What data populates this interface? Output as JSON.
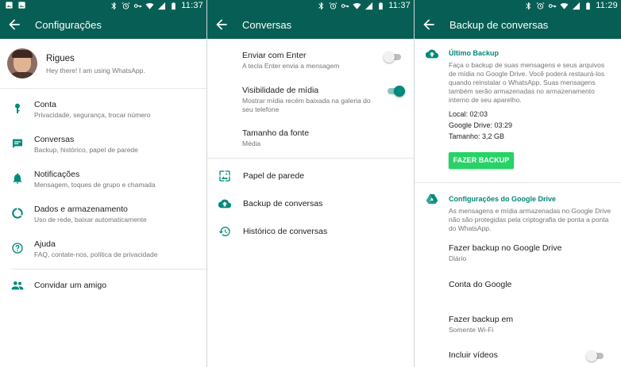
{
  "colors": {
    "header": "#075e54",
    "accent": "#00897b",
    "button": "#25d366"
  },
  "panels": [
    {
      "time": "11:37",
      "title": "Configurações",
      "profile": {
        "name": "Rigues",
        "status": "Hey there! I am using WhatsApp."
      },
      "items": [
        {
          "icon": "key-icon",
          "title": "Conta",
          "subtitle": "Privacidade, segurança, trocar número"
        },
        {
          "icon": "chat-icon",
          "title": "Conversas",
          "subtitle": "Backup, histórico, papel de parede"
        },
        {
          "icon": "bell-icon",
          "title": "Notificações",
          "subtitle": "Mensagem, toques de grupo e chamada"
        },
        {
          "icon": "data-usage-icon",
          "title": "Dados e armazenamento",
          "subtitle": "Uso de rede, baixar automaticamente"
        },
        {
          "icon": "help-icon",
          "title": "Ajuda",
          "subtitle": "FAQ, contate-nos, política de privacidade"
        }
      ],
      "invite": "Convidar um amigo"
    },
    {
      "time": "11:37",
      "title": "Conversas",
      "enter": {
        "title": "Enviar com Enter",
        "subtitle": "A tecla Enter envia a mensagem",
        "enabled": false
      },
      "media": {
        "title": "Visibilidade de mídia",
        "subtitle": "Mostrar mídia recém baixada na galeria do seu telefone",
        "enabled": true
      },
      "font": {
        "title": "Tamanho da fonte",
        "value": "Média"
      },
      "links": [
        "Papel de parede",
        "Backup de conversas",
        "Histórico de conversas"
      ]
    },
    {
      "time": "11:29",
      "title": "Backup de conversas",
      "last_backup": {
        "header": "Último Backup",
        "description": "Faça o backup de suas mensagens e seus arquivos de mídia no Google Drive. Você poderá restaurá-los quando reinstalar o WhatsApp. Suas mensagens também serão armazenadas no armazenamento interno de seu aparelho.",
        "local": "Local: 02:03",
        "drive": "Google Drive: 03:29",
        "size": "Tamanho: 3,2 GB",
        "button": "FAZER BACKUP"
      },
      "drive_settings": {
        "header": "Configurações do Google Drive",
        "description": "As mensagens e mídia armazenadas no Google Drive não são protegidas pela criptografia de ponta a ponta do WhatsApp.",
        "backup_to": {
          "title": "Fazer backup no Google Drive",
          "value": "Diário"
        },
        "account": {
          "title": "Conta do Google"
        },
        "backup_over": {
          "title": "Fazer backup em",
          "value": "Somente Wi-Fi"
        },
        "videos": {
          "title": "Incluir vídeos",
          "enabled": false
        }
      }
    }
  ]
}
